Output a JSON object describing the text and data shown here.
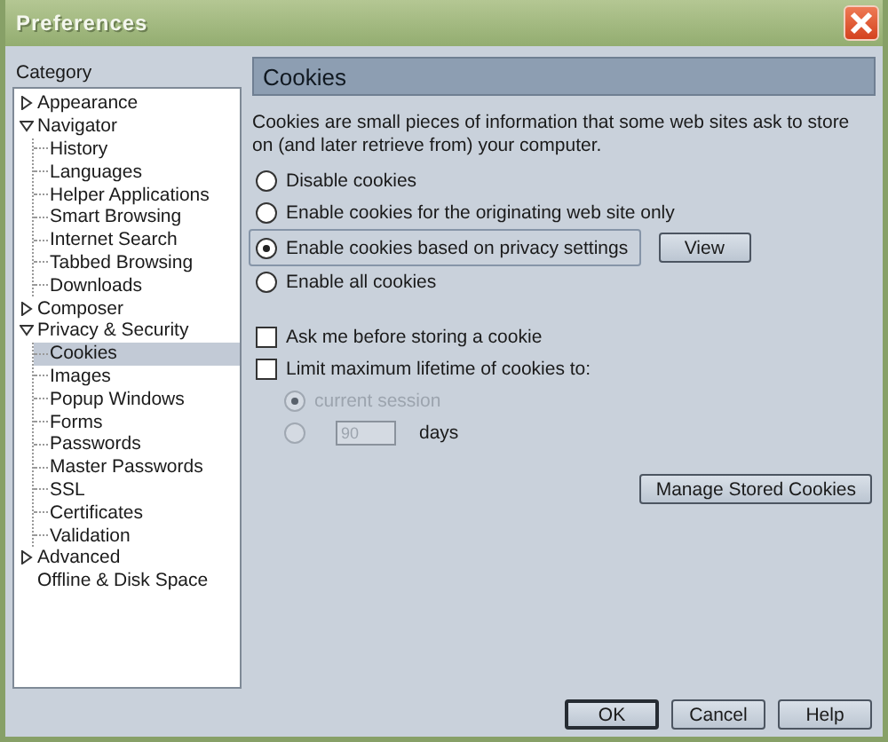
{
  "window": {
    "title": "Preferences"
  },
  "sidebar": {
    "label": "Category",
    "tree": [
      {
        "label": "Appearance",
        "expanded": false,
        "selected": false
      },
      {
        "label": "Navigator",
        "expanded": true,
        "selected": false,
        "children": [
          {
            "label": "History",
            "selected": false
          },
          {
            "label": "Languages",
            "selected": false
          },
          {
            "label": "Helper Applications",
            "selected": false
          },
          {
            "label": "Smart Browsing",
            "selected": false
          },
          {
            "label": "Internet Search",
            "selected": false
          },
          {
            "label": "Tabbed Browsing",
            "selected": false
          },
          {
            "label": "Downloads",
            "selected": false
          }
        ]
      },
      {
        "label": "Composer",
        "expanded": false,
        "selected": false
      },
      {
        "label": "Privacy & Security",
        "expanded": true,
        "selected": false,
        "children": [
          {
            "label": "Cookies",
            "selected": true
          },
          {
            "label": "Images",
            "selected": false
          },
          {
            "label": "Popup Windows",
            "selected": false
          },
          {
            "label": "Forms",
            "selected": false
          },
          {
            "label": "Passwords",
            "selected": false
          },
          {
            "label": "Master Passwords",
            "selected": false
          },
          {
            "label": "SSL",
            "selected": false
          },
          {
            "label": "Certificates",
            "selected": false
          },
          {
            "label": "Validation",
            "selected": false
          }
        ]
      },
      {
        "label": "Advanced",
        "expanded": false,
        "selected": false
      },
      {
        "label": "Offline & Disk Space",
        "selected": false
      }
    ]
  },
  "panel": {
    "title": "Cookies",
    "description": "Cookies are small pieces of information that some web sites ask to store on (and later retrieve from) your computer.",
    "cookie_policy": [
      {
        "label": "Disable cookies",
        "selected": false
      },
      {
        "label": "Enable cookies for the originating web site only",
        "selected": false
      },
      {
        "label": "Enable cookies based on privacy settings",
        "selected": true,
        "button": "View"
      },
      {
        "label": "Enable all cookies",
        "selected": false
      }
    ],
    "options": [
      {
        "label": "Ask me before storing a cookie",
        "checked": false
      },
      {
        "label": "Limit maximum lifetime of cookies to:",
        "checked": false
      }
    ],
    "lifetime": {
      "disabled": true,
      "choices": [
        {
          "kind": "plain",
          "label": "current session",
          "selected": true
        },
        {
          "kind": "days",
          "value": "90",
          "unit": "days",
          "selected": false
        }
      ]
    },
    "manage_button": "Manage Stored Cookies"
  },
  "buttons": [
    {
      "label": "OK",
      "default": true
    },
    {
      "label": "Cancel",
      "default": false
    },
    {
      "label": "Help",
      "default": false
    }
  ]
}
